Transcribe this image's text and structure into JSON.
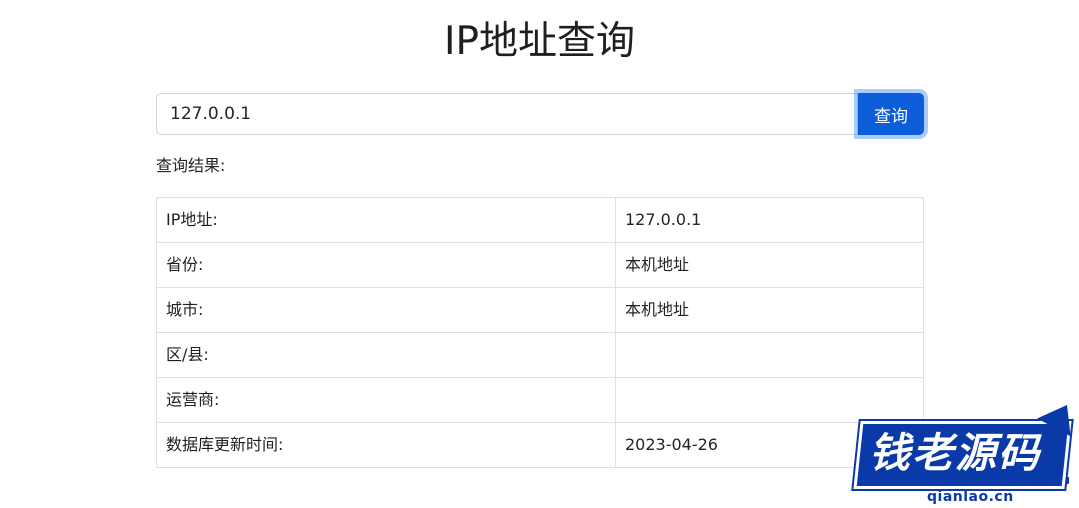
{
  "page": {
    "title": "IP地址查询"
  },
  "search": {
    "value": "127.0.0.1",
    "button_label": "查询"
  },
  "result": {
    "label": "查询结果:",
    "rows": [
      {
        "key": "IP地址:",
        "value": "127.0.0.1"
      },
      {
        "key": "省份:",
        "value": "本机地址"
      },
      {
        "key": "城市:",
        "value": "本机地址"
      },
      {
        "key": "区/县:",
        "value": ""
      },
      {
        "key": "运营商:",
        "value": ""
      },
      {
        "key": "数据库更新时间:",
        "value": "2023-04-26"
      }
    ]
  },
  "watermark": {
    "text": "钱老源码",
    "domain": "qianlao.cn"
  },
  "colors": {
    "primary_button": "#0b5ed7",
    "watermark_blue": "#0a3aa8"
  }
}
